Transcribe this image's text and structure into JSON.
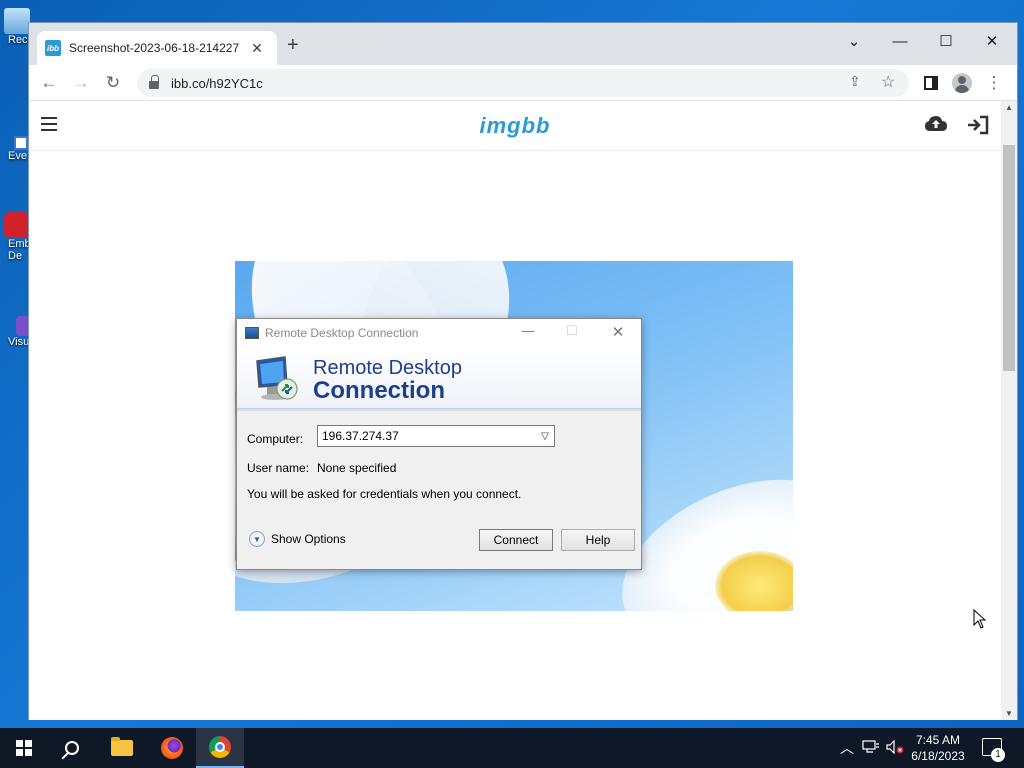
{
  "desktop": {
    "icons": [
      {
        "label": "Rec"
      },
      {
        "label": "Eve"
      },
      {
        "label": "Emb"
      },
      {
        "label": "De"
      },
      {
        "label": "Visu"
      }
    ]
  },
  "browser": {
    "tab": {
      "title": "Screenshot-2023-06-18-214227",
      "favicon": "ibb"
    },
    "new_tab_label": "+",
    "url": "ibb.co/h92YC1c",
    "window_controls": {
      "tabsearch": "⌄",
      "minimize": "—",
      "maximize": "☐",
      "close": "✕"
    }
  },
  "site": {
    "logo": "imgbb"
  },
  "rdc": {
    "window_title": "Remote Desktop Connection",
    "heading_line1": "Remote Desktop",
    "heading_line2": "Connection",
    "computer_label": "Computer:",
    "computer_value": "196.37.274.37",
    "username_label": "User name:",
    "username_value": "None specified",
    "credentials_message": "You will be asked for credentials when you connect.",
    "show_options_label": "Show Options",
    "connect_label": "Connect",
    "help_label": "Help"
  },
  "taskbar": {
    "time": "7:45 AM",
    "date": "6/18/2023",
    "notification_count": "1"
  },
  "colors": {
    "brand": "#2a9bd6",
    "rdc_heading": "#1d3f8c",
    "taskbar": "#0f1826",
    "desktop": "#1678d6"
  }
}
